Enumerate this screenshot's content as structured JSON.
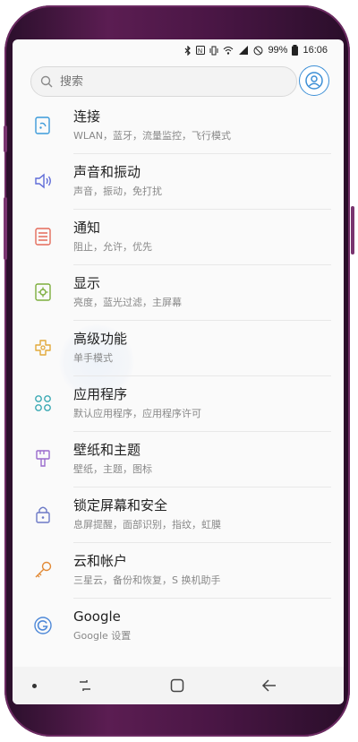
{
  "status_bar": {
    "battery_percent": "99%",
    "time": "16:06",
    "icons": [
      "bluetooth-icon",
      "nfc-icon",
      "vibrate-icon",
      "wifi-icon",
      "signal-icon",
      "do-not-disturb-icon",
      "battery-icon"
    ]
  },
  "search": {
    "placeholder": "搜索"
  },
  "settings": [
    {
      "title": "连接",
      "subtitle": "WLAN，蓝牙，流量监控，飞行模式",
      "icon": "connections-icon",
      "color": "#3b9ad9"
    },
    {
      "title": "声音和振动",
      "subtitle": "声音，振动，免打扰",
      "icon": "volume-icon",
      "color": "#5e6bd8"
    },
    {
      "title": "通知",
      "subtitle": "阻止，允许，优先",
      "icon": "notifications-icon",
      "color": "#e46b5a"
    },
    {
      "title": "显示",
      "subtitle": "亮度，蓝光过滤，主屏幕",
      "icon": "display-icon",
      "color": "#7cae3d"
    },
    {
      "title": "高级功能",
      "subtitle": "单手模式",
      "icon": "advanced-features-icon",
      "color": "#e2a93a"
    },
    {
      "title": "应用程序",
      "subtitle": "默认应用程序，应用程序许可",
      "icon": "apps-icon",
      "color": "#3aa9b3"
    },
    {
      "title": "壁纸和主题",
      "subtitle": "壁纸，主题，图标",
      "icon": "paintbrush-icon",
      "color": "#9a6bcd"
    },
    {
      "title": "锁定屏幕和安全",
      "subtitle": "息屏提醒，面部识别，指纹，虹膜",
      "icon": "lock-icon",
      "color": "#6c79c6"
    },
    {
      "title": "云和帐户",
      "subtitle": "三星云，备份和恢复，S 换机助手",
      "icon": "key-icon",
      "color": "#e28a36"
    },
    {
      "title": "Google",
      "subtitle": "Google 设置",
      "icon": "google-icon",
      "color": "#4f89d8"
    }
  ],
  "nav_bar": {
    "buttons": [
      "recent-apps-icon",
      "home-icon",
      "back-icon"
    ]
  }
}
